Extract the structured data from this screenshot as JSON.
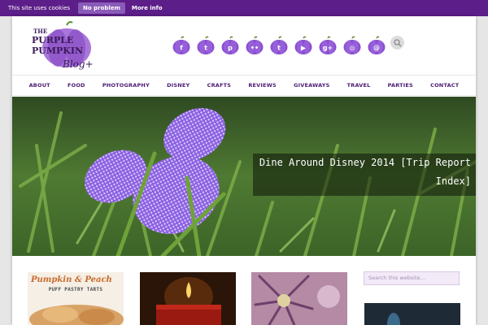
{
  "cookie_bar": {
    "text": "This site uses cookies",
    "dismiss_label": "No problem",
    "more_label": "More info"
  },
  "header": {
    "logo_line1": "THE",
    "logo_line2": "PURPLE",
    "logo_line3": "PUMPKIN",
    "logo_line4": "Blog+",
    "social_icons": [
      "facebook-icon",
      "twitter-icon",
      "pinterest-icon",
      "flickr-icon",
      "tumblr-icon",
      "youtube-icon",
      "google-plus-icon",
      "instagram-icon",
      "email-icon"
    ],
    "social_glyphs": [
      "f",
      "t",
      "p",
      "••",
      "t",
      "▶",
      "g+",
      "◎",
      "@"
    ]
  },
  "nav": {
    "items": [
      "ABOUT",
      "FOOD",
      "PHOTOGRAPHY",
      "DISNEY",
      "CRAFTS",
      "REVIEWS",
      "GIVEAWAYS",
      "TRAVEL",
      "PARTIES",
      "CONTACT"
    ]
  },
  "hero": {
    "caption_line1": "Dine Around Disney 2014 [Trip Report",
    "caption_line2": "Index]"
  },
  "posts": {
    "thumb1_title": "Pumpkin & Peach",
    "thumb1_sub": "PUFF PASTRY TARTS"
  },
  "sidebar": {
    "search_placeholder": "Search this website…"
  },
  "colors": {
    "brand_purple": "#5c1e88",
    "nav_text": "#4a1a73",
    "icon_purple": "#8a4fd0"
  }
}
